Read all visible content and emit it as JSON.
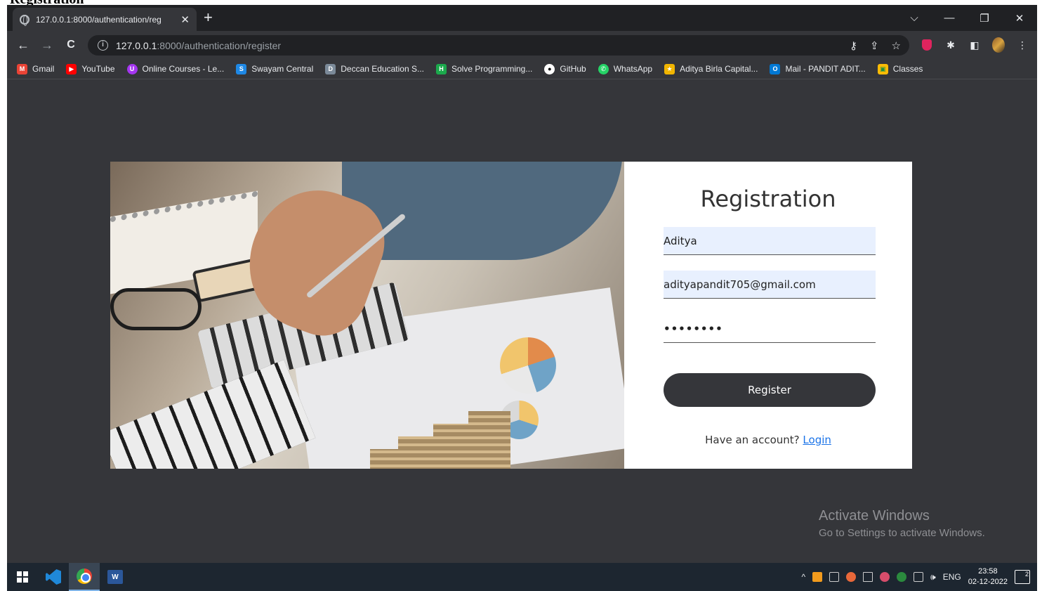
{
  "doc_heading": "Registration",
  "browser": {
    "tab_title": "127.0.0.1:8000/authentication/reg",
    "tab_close": "✕",
    "new_tab": "+",
    "window_controls": {
      "dropdown": "⌵",
      "minimize": "—",
      "restore": "❐",
      "close": "✕"
    },
    "nav": {
      "back": "←",
      "forward": "→",
      "reload": "C"
    },
    "url_host": "127.0.0.1",
    "url_path": ":8000/authentication/register",
    "bookmarks": [
      {
        "label": "Gmail",
        "icon": "gmail-icon",
        "color": "#ea4335"
      },
      {
        "label": "YouTube",
        "icon": "youtube-icon",
        "color": "#ff0000"
      },
      {
        "label": "Online Courses - Le...",
        "icon": "udemy-icon",
        "color": "#a435f0"
      },
      {
        "label": "Swayam Central",
        "icon": "swayam-icon",
        "color": "#1e88e5"
      },
      {
        "label": "Deccan Education S...",
        "icon": "deccan-icon",
        "color": "#7b8a99"
      },
      {
        "label": "Solve Programming...",
        "icon": "hackerrank-icon",
        "color": "#1ba94c"
      },
      {
        "label": "GitHub",
        "icon": "github-icon",
        "color": "#ffffff"
      },
      {
        "label": "WhatsApp",
        "icon": "whatsapp-icon",
        "color": "#25d366"
      },
      {
        "label": "Aditya Birla Capital...",
        "icon": "aditya-birla-icon",
        "color": "#f1b500"
      },
      {
        "label": "Mail - PANDIT ADIT...",
        "icon": "outlook-icon",
        "color": "#0078d4"
      },
      {
        "label": "Classes",
        "icon": "classroom-icon",
        "color": "#fbbc05"
      }
    ]
  },
  "page": {
    "title": "Registration",
    "fields": {
      "name_value": "Aditya",
      "email_value": "adityapandit705@gmail.com",
      "password_value": "••••••••"
    },
    "register_label": "Register",
    "have_account": "Have an account? ",
    "login_label": "Login"
  },
  "watermark": {
    "line1": "Activate Windows",
    "line2": "Go to Settings to activate Windows."
  },
  "taskbar": {
    "tray_caret": "^",
    "volume": "🕪",
    "language": "ENG",
    "time": "23:58",
    "date": "02-12-2022",
    "notification_count": "2"
  },
  "colors": {
    "page_background": "#35363a",
    "button_dark": "#35363a",
    "link": "#1a73e8",
    "autofill": "#e8f0fe"
  }
}
